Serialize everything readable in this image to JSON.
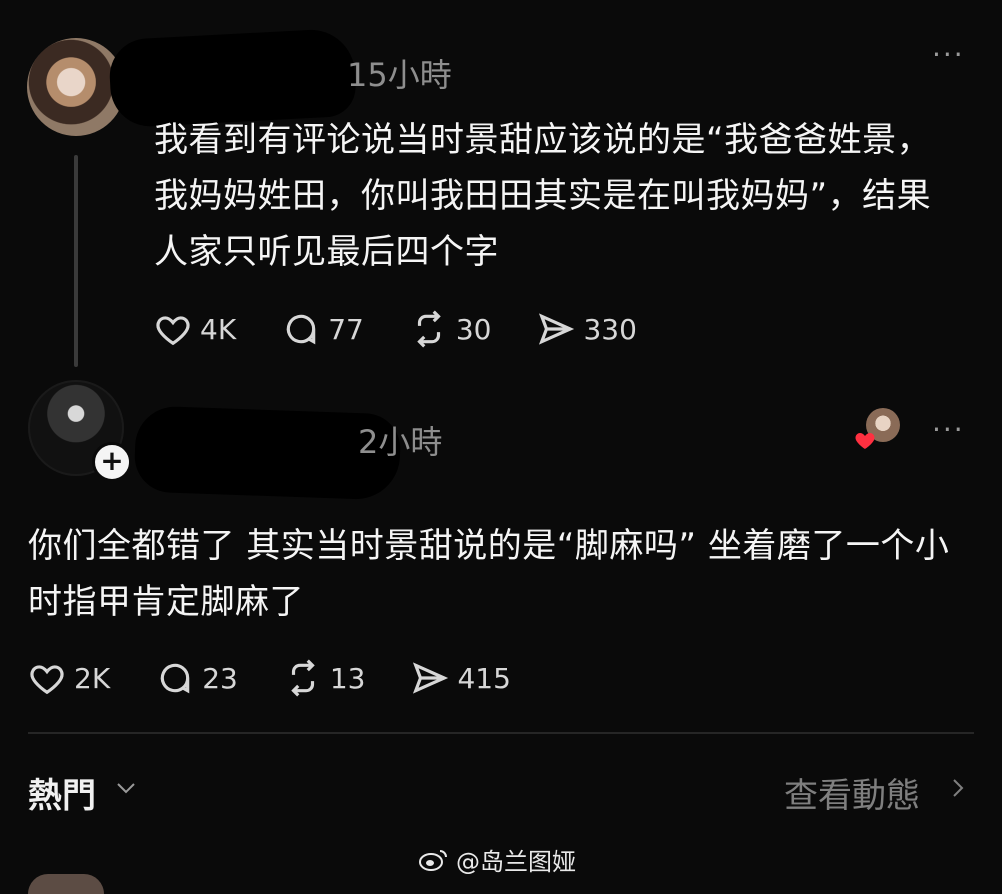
{
  "post1": {
    "time": "15小時",
    "text": "我看到有评论说当时景甜应该说的是“我爸爸姓景，我妈妈姓田，你叫我田田其实是在叫我妈妈”，结果人家只听见最后四个字",
    "more_label": "···",
    "likes": "4K",
    "comments": "77",
    "reposts": "30",
    "shares": "330"
  },
  "post2": {
    "time": "2小時",
    "text": "你们全都错了 其实当时景甜说的是“脚麻吗” 坐着磨了一个小时指甲肯定脚麻了",
    "more_label": "···",
    "likes": "2K",
    "comments": "23",
    "reposts": "13",
    "shares": "415"
  },
  "footer": {
    "hot_label": "熱門",
    "view_activity_label": "查看動態"
  },
  "watermark": "@岛兰图娅",
  "colors": {
    "background": "#0a0a0a",
    "text": "#f5f5f5",
    "muted": "#8e8e8e",
    "heart": "#ff3040"
  }
}
